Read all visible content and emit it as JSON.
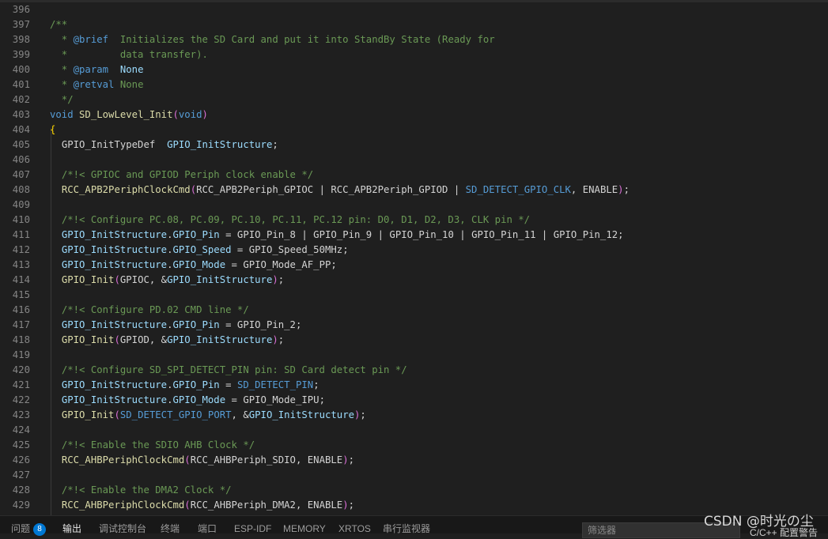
{
  "editor": {
    "lines": [
      {
        "n": "396",
        "tokens": []
      },
      {
        "n": "397",
        "tokens": [
          {
            "c": "comment",
            "t": "/**"
          }
        ]
      },
      {
        "n": "398",
        "tokens": [
          {
            "c": "comment",
            "t": "  * "
          },
          {
            "c": "doctag",
            "t": "@brief"
          },
          {
            "c": "comment",
            "t": "  Initializes the SD Card and put it into StandBy State (Ready for"
          }
        ]
      },
      {
        "n": "399",
        "tokens": [
          {
            "c": "comment",
            "t": "  *         data transfer)."
          }
        ]
      },
      {
        "n": "400",
        "tokens": [
          {
            "c": "comment",
            "t": "  * "
          },
          {
            "c": "doctag",
            "t": "@param"
          },
          {
            "c": "comment",
            "t": "  "
          },
          {
            "c": "var",
            "t": "None"
          }
        ]
      },
      {
        "n": "401",
        "tokens": [
          {
            "c": "comment",
            "t": "  * "
          },
          {
            "c": "doctag",
            "t": "@retval"
          },
          {
            "c": "comment",
            "t": " None"
          }
        ]
      },
      {
        "n": "402",
        "tokens": [
          {
            "c": "comment",
            "t": "  */"
          }
        ]
      },
      {
        "n": "403",
        "tokens": [
          {
            "c": "keyword",
            "t": "void"
          },
          {
            "c": "plain",
            "t": " "
          },
          {
            "c": "func",
            "t": "SD_LowLevel_Init"
          },
          {
            "c": "paren",
            "t": "("
          },
          {
            "c": "keyword",
            "t": "void"
          },
          {
            "c": "paren",
            "t": ")"
          }
        ]
      },
      {
        "n": "404",
        "tokens": [
          {
            "c": "brace",
            "t": "{"
          }
        ]
      },
      {
        "n": "405",
        "tokens": [
          {
            "c": "plain",
            "t": "  "
          },
          {
            "c": "type",
            "t": "GPIO_InitTypeDef"
          },
          {
            "c": "plain",
            "t": "  "
          },
          {
            "c": "var",
            "t": "GPIO_InitStructure"
          },
          {
            "c": "plain",
            "t": ";"
          }
        ]
      },
      {
        "n": "406",
        "tokens": []
      },
      {
        "n": "407",
        "tokens": [
          {
            "c": "plain",
            "t": "  "
          },
          {
            "c": "comment",
            "t": "/*!< GPIOC and GPIOD Periph clock enable */"
          }
        ]
      },
      {
        "n": "408",
        "tokens": [
          {
            "c": "plain",
            "t": "  "
          },
          {
            "c": "func",
            "t": "RCC_APB2PeriphClockCmd"
          },
          {
            "c": "paren",
            "t": "("
          },
          {
            "c": "plain",
            "t": "RCC_APB2Periph_GPIOC | RCC_APB2Periph_GPIOD | "
          },
          {
            "c": "macro",
            "t": "SD_DETECT_GPIO_CLK"
          },
          {
            "c": "plain",
            "t": ", ENABLE"
          },
          {
            "c": "paren",
            "t": ")"
          },
          {
            "c": "plain",
            "t": ";"
          }
        ]
      },
      {
        "n": "409",
        "tokens": []
      },
      {
        "n": "410",
        "tokens": [
          {
            "c": "plain",
            "t": "  "
          },
          {
            "c": "comment",
            "t": "/*!< Configure PC.08, PC.09, PC.10, PC.11, PC.12 pin: D0, D1, D2, D3, CLK pin */"
          }
        ]
      },
      {
        "n": "411",
        "tokens": [
          {
            "c": "plain",
            "t": "  "
          },
          {
            "c": "var",
            "t": "GPIO_InitStructure"
          },
          {
            "c": "plain",
            "t": "."
          },
          {
            "c": "var",
            "t": "GPIO_Pin"
          },
          {
            "c": "plain",
            "t": " = GPIO_Pin_8 | GPIO_Pin_9 | GPIO_Pin_10 | GPIO_Pin_11 | GPIO_Pin_12;"
          }
        ]
      },
      {
        "n": "412",
        "tokens": [
          {
            "c": "plain",
            "t": "  "
          },
          {
            "c": "var",
            "t": "GPIO_InitStructure"
          },
          {
            "c": "plain",
            "t": "."
          },
          {
            "c": "var",
            "t": "GPIO_Speed"
          },
          {
            "c": "plain",
            "t": " = GPIO_Speed_50MHz;"
          }
        ]
      },
      {
        "n": "413",
        "tokens": [
          {
            "c": "plain",
            "t": "  "
          },
          {
            "c": "var",
            "t": "GPIO_InitStructure"
          },
          {
            "c": "plain",
            "t": "."
          },
          {
            "c": "var",
            "t": "GPIO_Mode"
          },
          {
            "c": "plain",
            "t": " = GPIO_Mode_AF_PP;"
          }
        ]
      },
      {
        "n": "414",
        "tokens": [
          {
            "c": "plain",
            "t": "  "
          },
          {
            "c": "func",
            "t": "GPIO_Init"
          },
          {
            "c": "paren",
            "t": "("
          },
          {
            "c": "plain",
            "t": "GPIOC, &"
          },
          {
            "c": "var",
            "t": "GPIO_InitStructure"
          },
          {
            "c": "paren",
            "t": ")"
          },
          {
            "c": "plain",
            "t": ";"
          }
        ]
      },
      {
        "n": "415",
        "tokens": []
      },
      {
        "n": "416",
        "tokens": [
          {
            "c": "plain",
            "t": "  "
          },
          {
            "c": "comment",
            "t": "/*!< Configure PD.02 CMD line */"
          }
        ]
      },
      {
        "n": "417",
        "tokens": [
          {
            "c": "plain",
            "t": "  "
          },
          {
            "c": "var",
            "t": "GPIO_InitStructure"
          },
          {
            "c": "plain",
            "t": "."
          },
          {
            "c": "var",
            "t": "GPIO_Pin"
          },
          {
            "c": "plain",
            "t": " = GPIO_Pin_2;"
          }
        ]
      },
      {
        "n": "418",
        "tokens": [
          {
            "c": "plain",
            "t": "  "
          },
          {
            "c": "func",
            "t": "GPIO_Init"
          },
          {
            "c": "paren",
            "t": "("
          },
          {
            "c": "plain",
            "t": "GPIOD, &"
          },
          {
            "c": "var",
            "t": "GPIO_InitStructure"
          },
          {
            "c": "paren",
            "t": ")"
          },
          {
            "c": "plain",
            "t": ";"
          }
        ]
      },
      {
        "n": "419",
        "tokens": []
      },
      {
        "n": "420",
        "tokens": [
          {
            "c": "plain",
            "t": "  "
          },
          {
            "c": "comment",
            "t": "/*!< Configure SD_SPI_DETECT_PIN pin: SD Card detect pin */"
          }
        ]
      },
      {
        "n": "421",
        "tokens": [
          {
            "c": "plain",
            "t": "  "
          },
          {
            "c": "var",
            "t": "GPIO_InitStructure"
          },
          {
            "c": "plain",
            "t": "."
          },
          {
            "c": "var",
            "t": "GPIO_Pin"
          },
          {
            "c": "plain",
            "t": " = "
          },
          {
            "c": "macro",
            "t": "SD_DETECT_PIN"
          },
          {
            "c": "plain",
            "t": ";"
          }
        ]
      },
      {
        "n": "422",
        "tokens": [
          {
            "c": "plain",
            "t": "  "
          },
          {
            "c": "var",
            "t": "GPIO_InitStructure"
          },
          {
            "c": "plain",
            "t": "."
          },
          {
            "c": "var",
            "t": "GPIO_Mode"
          },
          {
            "c": "plain",
            "t": " = GPIO_Mode_IPU;"
          }
        ]
      },
      {
        "n": "423",
        "tokens": [
          {
            "c": "plain",
            "t": "  "
          },
          {
            "c": "func",
            "t": "GPIO_Init"
          },
          {
            "c": "paren",
            "t": "("
          },
          {
            "c": "macro",
            "t": "SD_DETECT_GPIO_PORT"
          },
          {
            "c": "plain",
            "t": ", &"
          },
          {
            "c": "var",
            "t": "GPIO_InitStructure"
          },
          {
            "c": "paren",
            "t": ")"
          },
          {
            "c": "plain",
            "t": ";"
          }
        ]
      },
      {
        "n": "424",
        "tokens": []
      },
      {
        "n": "425",
        "tokens": [
          {
            "c": "plain",
            "t": "  "
          },
          {
            "c": "comment",
            "t": "/*!< Enable the SDIO AHB Clock */"
          }
        ]
      },
      {
        "n": "426",
        "tokens": [
          {
            "c": "plain",
            "t": "  "
          },
          {
            "c": "func",
            "t": "RCC_AHBPeriphClockCmd"
          },
          {
            "c": "paren",
            "t": "("
          },
          {
            "c": "plain",
            "t": "RCC_AHBPeriph_SDIO, ENABLE"
          },
          {
            "c": "paren",
            "t": ")"
          },
          {
            "c": "plain",
            "t": ";"
          }
        ]
      },
      {
        "n": "427",
        "tokens": []
      },
      {
        "n": "428",
        "tokens": [
          {
            "c": "plain",
            "t": "  "
          },
          {
            "c": "comment",
            "t": "/*!< Enable the DMA2 Clock */"
          }
        ]
      },
      {
        "n": "429",
        "tokens": [
          {
            "c": "plain",
            "t": "  "
          },
          {
            "c": "func",
            "t": "RCC_AHBPeriphClockCmd"
          },
          {
            "c": "paren",
            "t": "("
          },
          {
            "c": "plain",
            "t": "RCC_AHBPeriph_DMA2, ENABLE"
          },
          {
            "c": "paren",
            "t": ")"
          },
          {
            "c": "plain",
            "t": ";"
          }
        ]
      }
    ]
  },
  "panel": {
    "tabs": [
      {
        "label": "问题",
        "badge": "8",
        "active": false
      },
      {
        "label": "输出",
        "active": true
      },
      {
        "label": "调试控制台",
        "active": false
      },
      {
        "label": "终端",
        "active": false
      },
      {
        "label": "端口",
        "active": false
      },
      {
        "label": "ESP-IDF",
        "active": false
      },
      {
        "label": "MEMORY",
        "active": false
      },
      {
        "label": "XRTOS",
        "active": false
      },
      {
        "label": "串行监视器",
        "active": false
      }
    ],
    "filter_placeholder": "筛选器",
    "output_channel": "C/C++ 配置警告"
  },
  "watermark": "CSDN @时光の尘",
  "colors": {
    "editor_bg": "#1f1f1f",
    "comment": "#6a9955",
    "keyword": "#569cd6",
    "function": "#dcdcaa",
    "variable": "#9cdcfe",
    "bracket_paren": "#da70d6",
    "bracket_brace": "#ffd700",
    "line_number": "#858585",
    "badge": "#0078d4"
  }
}
